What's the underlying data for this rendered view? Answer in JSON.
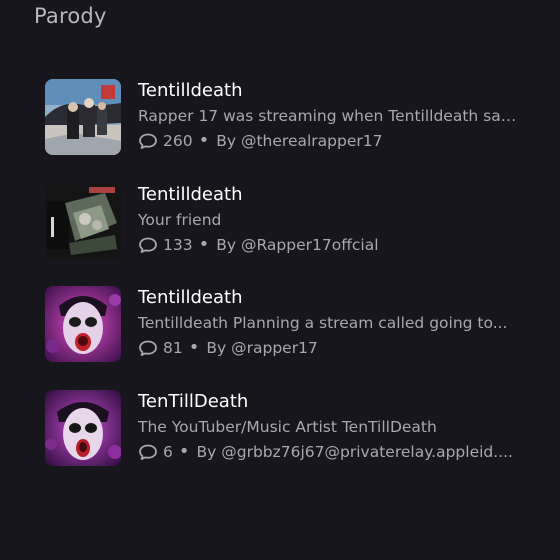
{
  "section": {
    "title": "Parody"
  },
  "items": [
    {
      "name": "Tentilldeath",
      "description": "Rapper 17 was streaming when Tentilldeath sai...",
      "count": "260",
      "by_label": "By",
      "author": "@therealrapper17"
    },
    {
      "name": "Tentilldeath",
      "description": "Your friend",
      "count": "133",
      "by_label": "By",
      "author": "@Rapper17offcial"
    },
    {
      "name": "Tentilldeath",
      "description": "Tentilldeath Planning a stream called going to...",
      "count": "81",
      "by_label": "By",
      "author": "@rapper17"
    },
    {
      "name": "TenTillDeath",
      "description": "The YouTuber/Music Artist TenTillDeath",
      "count": "6",
      "by_label": "By",
      "author": "@grbbz76j67@privaterelay.appleid...."
    }
  ],
  "icons": {
    "comment": "chat-bubble-icon"
  },
  "colors": {
    "background": "#17161c",
    "primary_text": "#ffffff",
    "secondary_text": "#a9a7b0",
    "section_title": "#b9b7c0"
  }
}
